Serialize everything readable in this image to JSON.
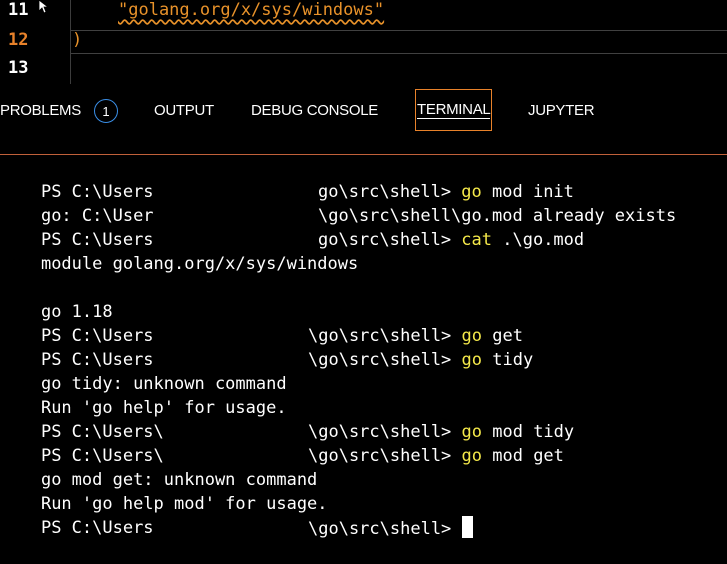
{
  "editor": {
    "lines": [
      {
        "num": "11",
        "code": "\"golang.org/x/sys/windows\""
      },
      {
        "num": "12",
        "code": ")"
      },
      {
        "num": "13",
        "code": ""
      }
    ]
  },
  "tabs": {
    "problems": "PROBLEMS",
    "problems_count": "1",
    "output": "OUTPUT",
    "debug_console": "DEBUG CONSOLE",
    "terminal": "TERMINAL",
    "jupyter": "JUPYTER"
  },
  "terminal": {
    "lines": [
      {
        "head": "PS C:\\Users",
        "tail_plain": "go\\src\\shell> ",
        "tail_cmd": "go",
        "tail_rest": " mod init"
      },
      {
        "head": "go: C:\\User",
        "tail_plain": "\\go\\src\\shell\\go.mod already exists",
        "tail_cmd": "",
        "tail_rest": ""
      },
      {
        "head": "PS C:\\Users",
        "tail_plain": "go\\src\\shell> ",
        "tail_cmd": "cat",
        "tail_rest": " .\\go.mod"
      },
      {
        "head": "module golang.org/x/sys/windows",
        "tail_plain": "",
        "tail_cmd": "",
        "tail_rest": ""
      },
      {
        "head": "",
        "tail_plain": "",
        "tail_cmd": "",
        "tail_rest": ""
      },
      {
        "head": "go 1.18",
        "tail_plain": "",
        "tail_cmd": "",
        "tail_rest": ""
      },
      {
        "head": "PS C:\\Users",
        "tail_plain": "\\go\\src\\shell> ",
        "tail_cmd": "go",
        "tail_rest": " get"
      },
      {
        "head": "PS C:\\Users",
        "tail_plain": "\\go\\src\\shell> ",
        "tail_cmd": "go",
        "tail_rest": " tidy"
      },
      {
        "head": "go tidy: unknown command",
        "tail_plain": "",
        "tail_cmd": "",
        "tail_rest": ""
      },
      {
        "head": "Run 'go help' for usage.",
        "tail_plain": "",
        "tail_cmd": "",
        "tail_rest": ""
      },
      {
        "head": "PS C:\\Users\\",
        "tail_plain": "\\go\\src\\shell> ",
        "tail_cmd": "go",
        "tail_rest": " mod tidy"
      },
      {
        "head": "PS C:\\Users\\",
        "tail_plain": "\\go\\src\\shell> ",
        "tail_cmd": "go",
        "tail_rest": " mod get"
      },
      {
        "head": "go mod get: unknown command",
        "tail_plain": "",
        "tail_cmd": "",
        "tail_rest": ""
      },
      {
        "head": "Run 'go help mod' for usage.",
        "tail_plain": "",
        "tail_cmd": "",
        "tail_rest": ""
      },
      {
        "head": "PS C:\\Users",
        "tail_plain": "\\go\\src\\shell> ",
        "tail_cmd": "",
        "tail_rest": ""
      }
    ]
  },
  "colors": {
    "background": "#000000",
    "accent_orange": "#e8822a",
    "command_yellow": "#f5e94a",
    "badge_blue": "#3a8ee6"
  }
}
